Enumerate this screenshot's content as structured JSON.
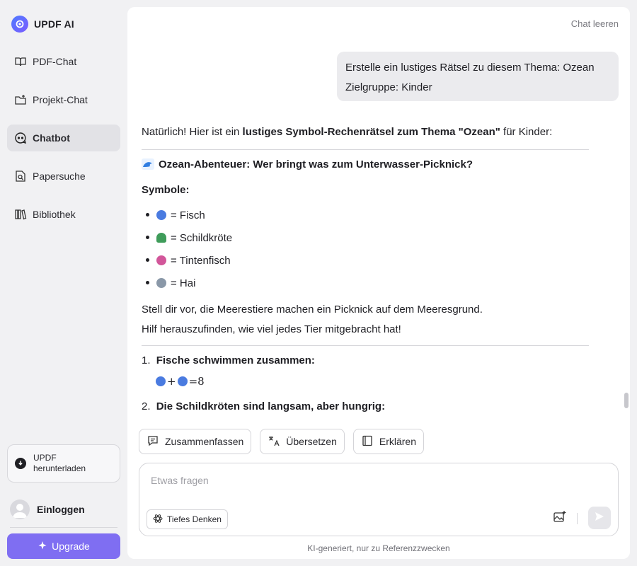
{
  "app": {
    "name": "UPDF AI"
  },
  "sidebar": {
    "items": [
      {
        "label": "PDF-Chat",
        "icon": "book-open-icon",
        "active": false
      },
      {
        "label": "Projekt-Chat",
        "icon": "folder-icon",
        "active": false
      },
      {
        "label": "Chatbot",
        "icon": "chat-bot-icon",
        "active": true
      },
      {
        "label": "Papersuche",
        "icon": "doc-search-icon",
        "active": false
      },
      {
        "label": "Bibliothek",
        "icon": "library-icon",
        "active": false
      }
    ],
    "download_label": "UPDF herunterladen",
    "download_line1": "UPDF",
    "download_line2": "herunterladen",
    "login_label": "Einloggen",
    "upgrade_label": "Upgrade"
  },
  "header": {
    "clear_chat": "Chat leeren"
  },
  "conversation": {
    "user_message": {
      "line1": "Erstelle ein lustiges Rätsel zu diesem Thema: Ozean",
      "line2": "Zielgruppe: Kinder"
    },
    "answer": {
      "intro_prefix": "Natürlich! Hier ist ein ",
      "intro_bold": "lustiges Symbol-Rechenrätsel zum Thema \"Ozean\"",
      "intro_suffix": " für Kinder:",
      "heading": "Ozean-Abenteuer: Wer bringt was zum Unterwasser-Picknick?",
      "symbols_label": "Symbole:",
      "symbols": [
        {
          "text": "= Fisch",
          "icon": "fish-emoji",
          "color": "#4a7be0"
        },
        {
          "text": "= Schildkröte",
          "icon": "turtle-emoji",
          "color": "#3f9c5a"
        },
        {
          "text": "= Tintenfisch",
          "icon": "octopus-emoji",
          "color": "#d2569a"
        },
        {
          "text": "= Hai",
          "icon": "shark-emoji",
          "color": "#8a98a8"
        }
      ],
      "story_line1": "Stell dir vor, die Meerestiere machen ein Picknick auf dem Meeresgrund.",
      "story_line2": "Hilf herauszufinden, wie viel jedes Tier mitgebracht hat!",
      "step1_number": "1.",
      "step1_title": "Fische schwimmen zusammen:",
      "step1_equation_op": "+",
      "step1_equation_result": "=8",
      "step2_number": "2.",
      "step2_title": "Die Schildkröten sind langsam, aber hungrig:"
    }
  },
  "actions": [
    {
      "label": "Zusammenfassen",
      "icon": "summary-icon"
    },
    {
      "label": "Übersetzen",
      "icon": "translate-icon"
    },
    {
      "label": "Erklären",
      "icon": "explain-book-icon"
    }
  ],
  "composer": {
    "placeholder": "Etwas fragen",
    "value": "",
    "deep_thinking_label": "Tiefes Denken"
  },
  "disclaimer": "KI-generiert, nur zu Referenzzwecken",
  "colors": {
    "accent": "#7f6ef2",
    "user_bubble": "#ebebee",
    "background": "#f1f1f3"
  }
}
